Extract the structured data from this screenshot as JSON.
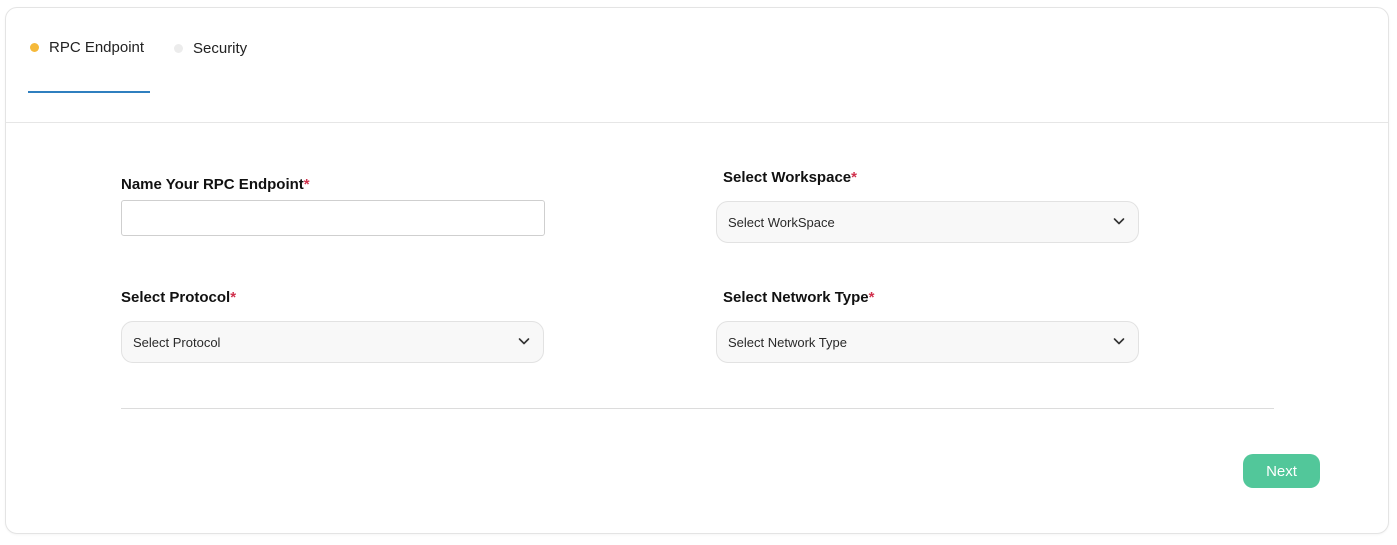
{
  "tabs": [
    {
      "label": "RPC Endpoint",
      "dot_color": "#f5b93a",
      "active": true
    },
    {
      "label": "Security",
      "dot_color": "#ececec",
      "active": false
    }
  ],
  "form": {
    "name": {
      "label": "Name Your RPC Endpoint",
      "required_mark": "*",
      "value": "",
      "placeholder": ""
    },
    "workspace": {
      "label": "Select Workspace",
      "required_mark": "*",
      "selected": "Select WorkSpace"
    },
    "protocol": {
      "label": "Select Protocol",
      "required_mark": "*",
      "selected": "Select Protocol"
    },
    "network": {
      "label": "Select Network Type",
      "required_mark": "*",
      "selected": "Select Network Type"
    }
  },
  "next_button": {
    "label": "Next",
    "color": "#52c79a"
  },
  "icons": {
    "select_arrow": "chevron-down-icon"
  }
}
